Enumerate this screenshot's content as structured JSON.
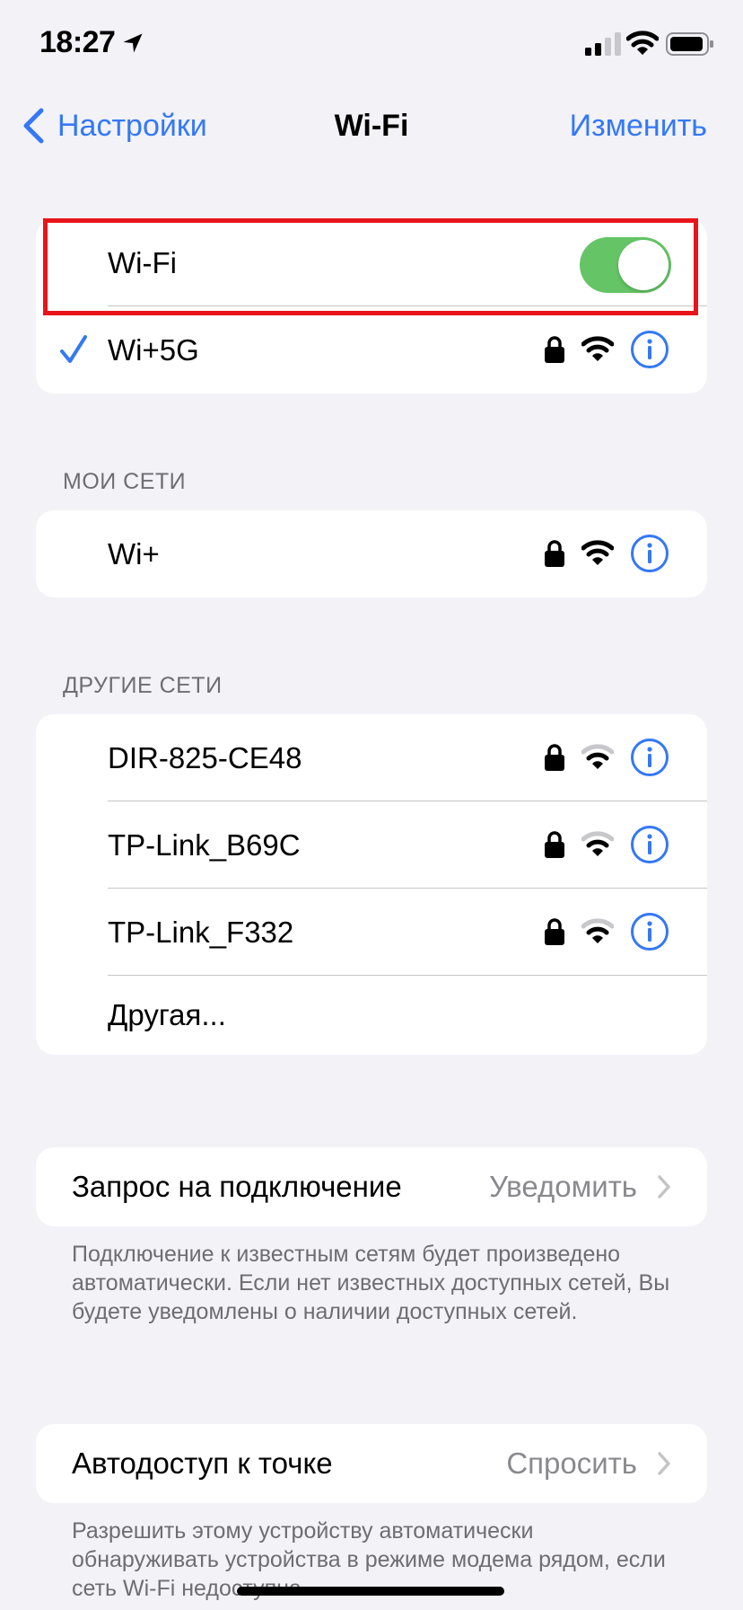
{
  "status_bar": {
    "time": "18:27",
    "icons": [
      "location-arrow-icon",
      "cellular-signal-icon",
      "wifi-icon",
      "battery-icon"
    ]
  },
  "nav": {
    "back_label": "Настройки",
    "title": "Wi-Fi",
    "edit_label": "Изменить"
  },
  "wifi_toggle": {
    "label": "Wi-Fi",
    "on": true,
    "color": "#65c466"
  },
  "connected_network": {
    "name": "Wi+5G",
    "secured": true
  },
  "my_networks": {
    "header": "МОИ СЕТИ",
    "items": [
      {
        "name": "Wi+",
        "secured": true
      }
    ]
  },
  "other_networks": {
    "header": "ДРУГИЕ СЕТИ",
    "items": [
      {
        "name": "DIR-825-CE48",
        "secured": true
      },
      {
        "name": "TP-Link_B69C",
        "secured": true
      },
      {
        "name": "TP-Link_F332",
        "secured": true
      }
    ],
    "other_label": "Другая..."
  },
  "ask_to_join": {
    "label": "Запрос на подключение",
    "value": "Уведомить",
    "footer": "Подключение к известным сетям будет произведено автоматически. Если нет известных доступных сетей, Вы будете уведомлены о наличии доступных сетей."
  },
  "auto_hotspot": {
    "label": "Автодоступ к точке",
    "value": "Спросить",
    "footer": "Разрешить этому устройству автоматически обнаруживать устройства в режиме модема рядом, если сеть Wi-Fi недоступна."
  },
  "colors": {
    "accent": "#3478f6",
    "background": "#f2f2f7",
    "highlight": "#e8141a"
  }
}
